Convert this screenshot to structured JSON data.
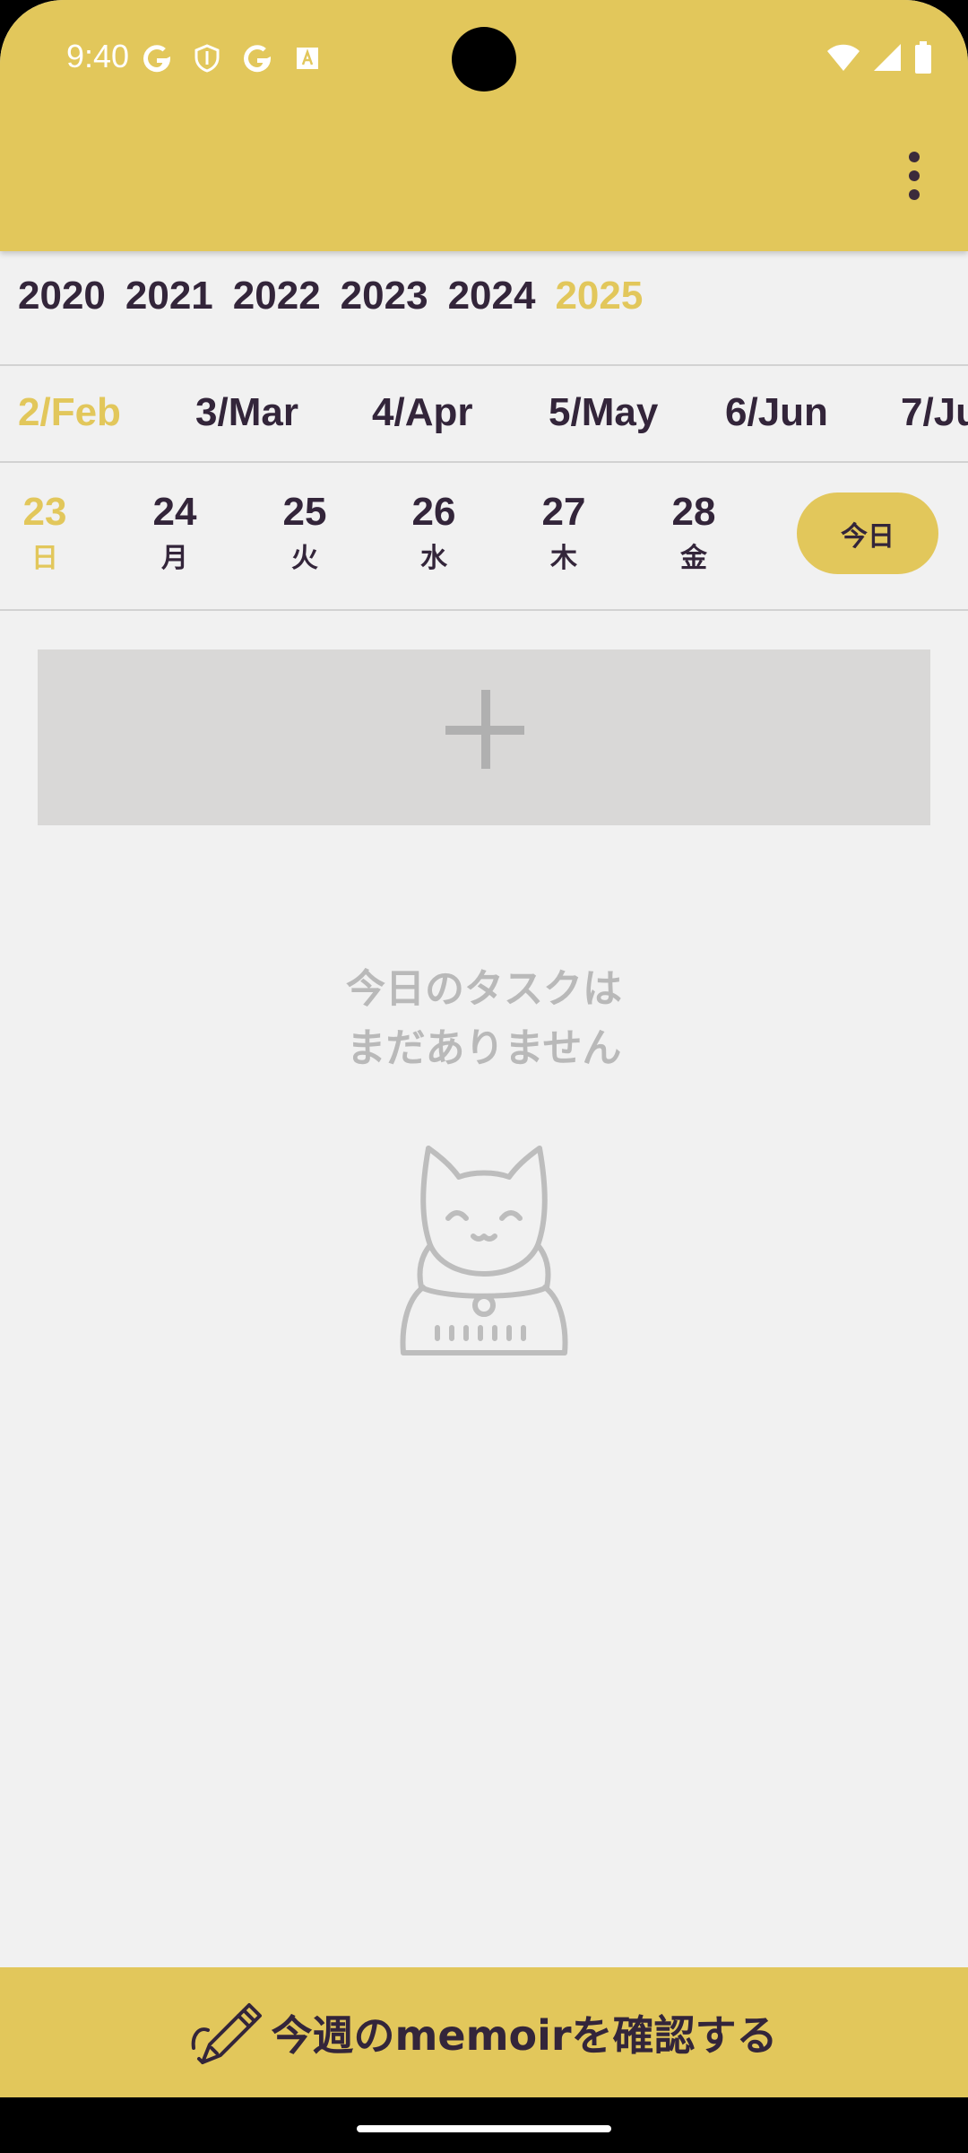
{
  "status_bar": {
    "time": "9:40",
    "left_icons": [
      "google-icon",
      "shield-icon",
      "google-icon",
      "translate-icon"
    ],
    "right_icons": [
      "wifi-icon",
      "signal-icon",
      "battery-icon"
    ]
  },
  "header": {
    "menu_icon": "more-vert-icon"
  },
  "years": {
    "items": [
      "2020",
      "2021",
      "2022",
      "2023",
      "2024",
      "2025"
    ],
    "selected": "2025"
  },
  "months": {
    "items": [
      "2/Feb",
      "3/Mar",
      "4/Apr",
      "5/May",
      "6/Jun",
      "7/Ju"
    ],
    "selected": "2/Feb"
  },
  "days": {
    "items": [
      {
        "num": "23",
        "weekday": "日"
      },
      {
        "num": "24",
        "weekday": "月"
      },
      {
        "num": "25",
        "weekday": "火"
      },
      {
        "num": "26",
        "weekday": "水"
      },
      {
        "num": "27",
        "weekday": "木"
      },
      {
        "num": "28",
        "weekday": "金"
      }
    ],
    "selected": "23",
    "today_label": "今日"
  },
  "add_task": {
    "icon": "plus-icon"
  },
  "empty_state": {
    "line1": "今日のタスクは",
    "line2": "まだありません",
    "icon": "lucky-cat-icon"
  },
  "memoir_bar": {
    "label": "今週のmemoirを確認する",
    "icon": "pen-icon"
  },
  "colors": {
    "accent": "#e2c75b",
    "text": "#33253a",
    "background": "#f1f1f1",
    "muted": "#b9b9b9"
  }
}
